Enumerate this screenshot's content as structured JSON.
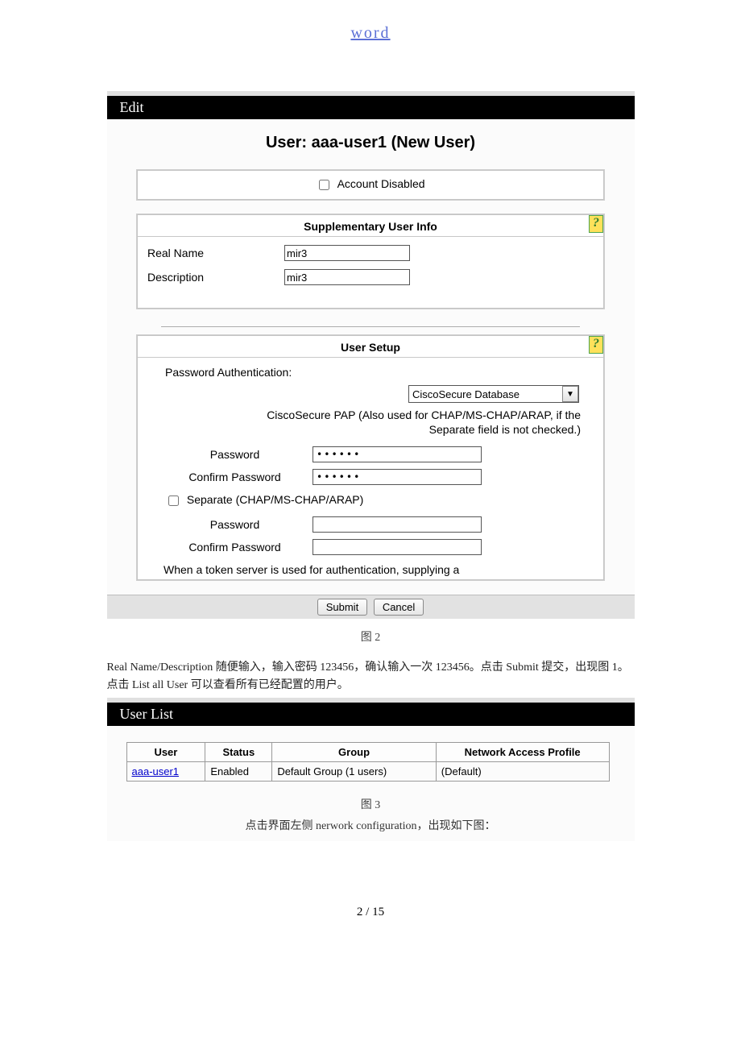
{
  "doc_link": "word",
  "edit_bar": "Edit",
  "user_title": "User: aaa-user1 (New User)",
  "account_disabled_label": "Account Disabled",
  "supp": {
    "header": "Supplementary User Info",
    "real_name_label": "Real Name",
    "real_name_value": "mir3",
    "description_label": "Description",
    "description_value": "mir3"
  },
  "help_glyph": "?",
  "usersetup": {
    "header": "User Setup",
    "pw_auth_label": "Password Authentication:",
    "db_select": "CiscoSecure Database",
    "pap_note_1": "CiscoSecure PAP (Also used for CHAP/MS-CHAP/ARAP, if the",
    "pap_note_2": "Separate field is not checked.)",
    "password_label": "Password",
    "confirm_label": "Confirm Password",
    "pw_value": "••••••",
    "confirm_value": "••••••",
    "separate_label": "Separate (CHAP/MS-CHAP/ARAP)",
    "sep_password_label": "Password",
    "sep_confirm_label": "Confirm Password",
    "token_note": "When a token server is used for authentication, supplying a"
  },
  "buttons": {
    "submit": "Submit",
    "cancel": "Cancel"
  },
  "fig2": "图 2",
  "cn_paragraph": "Real Name/Description 随便输入，输入密码 123456，确认输入一次 123456。点击 Submit 提交，出现图 1。点击 List all User 可以查看所有已经配置的用户。",
  "userlist_bar": "User List",
  "ulist": {
    "headers": [
      "User",
      "Status",
      "Group",
      "Network Access Profile"
    ],
    "row": {
      "user": "aaa-user1",
      "status": "Enabled",
      "group": "Default Group (1 users)",
      "nap": "(Default)"
    }
  },
  "fig3": "图 3",
  "cn_sub": "点击界面左侧 nerwork configuration，出现如下图：",
  "footer": "2 / 15"
}
